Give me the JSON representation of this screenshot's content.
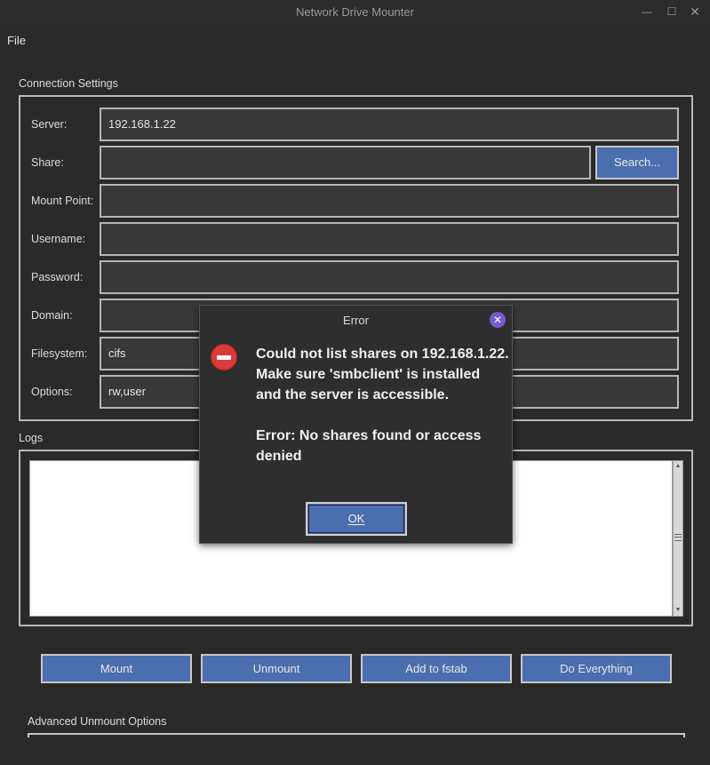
{
  "window": {
    "title": "Network Drive Mounter",
    "minimize_glyph": "—",
    "maximize_glyph": "☐",
    "close_glyph": "✕"
  },
  "menu": {
    "file": "File"
  },
  "connection": {
    "section_label": "Connection Settings",
    "server_label": "Server:",
    "server_value": "192.168.1.22",
    "share_label": "Share:",
    "share_value": "",
    "search_button": "Search...",
    "mount_point_label": "Mount Point:",
    "mount_point_value": "",
    "username_label": "Username:",
    "username_value": "",
    "password_label": "Password:",
    "password_value": "",
    "domain_label": "Domain:",
    "domain_value": "",
    "filesystem_label": "Filesystem:",
    "filesystem_value": "cifs",
    "options_label": "Options:",
    "options_value": "rw,user"
  },
  "logs": {
    "section_label": "Logs",
    "content": ""
  },
  "actions": {
    "mount": "Mount",
    "unmount": "Unmount",
    "add_to_fstab": "Add to fstab",
    "do_everything": "Do Everything"
  },
  "advanced": {
    "section_label": "Advanced Unmount Options"
  },
  "dialog": {
    "title": "Error",
    "message": "Could not list shares on 192.168.1.22. Make sure 'smbclient' is installed and the server is accessible.\n\nError: No shares found or access denied",
    "ok_button": "OK",
    "close_glyph": "✕"
  },
  "colors": {
    "background": "#2a2a2a",
    "button_blue": "#4b6eaf",
    "field_bg": "#393939",
    "error_red": "#d93a3a",
    "dialog_close_purple": "#7a5acf"
  }
}
